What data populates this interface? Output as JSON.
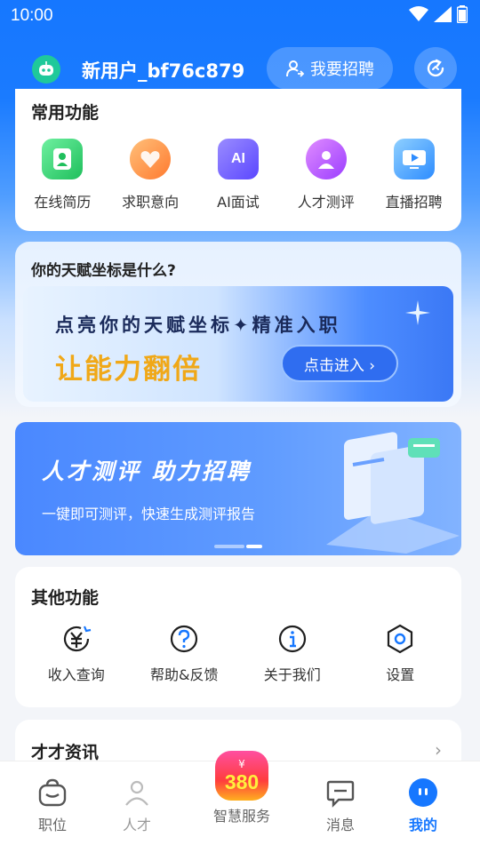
{
  "status_bar": {
    "time": "10:00"
  },
  "header": {
    "username": "新用户_bf76c879",
    "recruit_label": "我要招聘"
  },
  "common": {
    "title": "常用功能",
    "items": [
      {
        "label": "在线简历",
        "icon": "resume-icon",
        "color": "#2fd06e"
      },
      {
        "label": "求职意向",
        "icon": "intent-icon",
        "color": "#ff8a3d"
      },
      {
        "label": "AI面试",
        "icon": "ai-interview-icon",
        "color": "#6a5cff"
      },
      {
        "label": "人才测评",
        "icon": "talent-eval-icon",
        "color": "#b14cff"
      },
      {
        "label": "直播招聘",
        "icon": "live-icon",
        "color": "#3aa3ff"
      }
    ]
  },
  "talent": {
    "title": "你的天赋坐标是什么?",
    "line1": "点亮你的天赋坐标✦精准入职",
    "line2": "让能力翻倍",
    "button": "点击进入 ›"
  },
  "promo": {
    "title": "人才测评  助力招聘",
    "subtitle": "一键即可测评，快速生成测评报告"
  },
  "other": {
    "title": "其他功能",
    "items": [
      {
        "label": "收入查询",
        "icon": "income-icon"
      },
      {
        "label": "帮助&反馈",
        "icon": "help-icon"
      },
      {
        "label": "关于我们",
        "icon": "info-icon"
      },
      {
        "label": "设置",
        "icon": "settings-icon"
      }
    ]
  },
  "news": {
    "title": "才才资讯"
  },
  "tabbar": {
    "tabs": [
      {
        "label": "职位",
        "icon": "briefcase-icon"
      },
      {
        "label": "人才",
        "icon": "talent-icon"
      },
      {
        "label": "智慧服务",
        "badge": "380"
      },
      {
        "label": "消息",
        "icon": "message-icon"
      },
      {
        "label": "我的",
        "icon": "profile-icon"
      }
    ]
  },
  "colors": {
    "accent": "#1677ff",
    "badge_gradient_top": "#ff4fa0",
    "badge_number": "#ffef3d"
  }
}
